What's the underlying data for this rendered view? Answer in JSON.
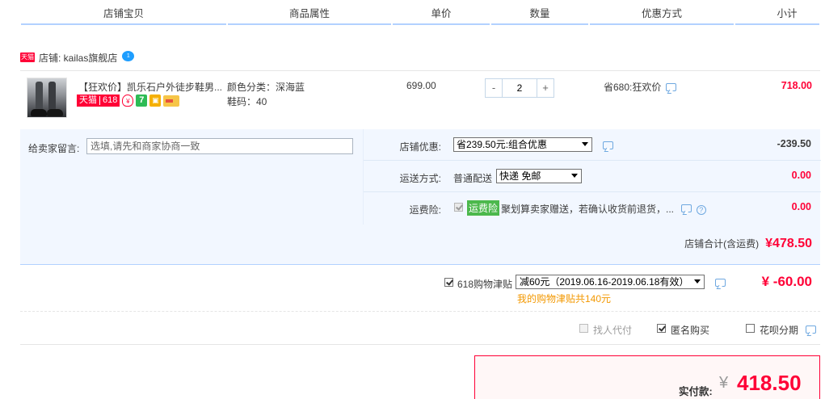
{
  "columns": {
    "item": "店铺宝贝",
    "attrs": "商品属性",
    "unit_price": "单价",
    "quantity": "数量",
    "discount_type": "优惠方式",
    "subtotal": "小计"
  },
  "shop": {
    "badge": "天猫",
    "name": "店铺: kailas旗舰店",
    "chat_badge": "1"
  },
  "item": {
    "title": "【狂欢价】凯乐石户外徒步鞋男...",
    "badge_tmall": "天猫",
    "badge_618": "618",
    "badge_guarantee": "¥",
    "badge_seven": "7",
    "attr_color": "颜色分类：深海蓝",
    "attr_size": "鞋码：40",
    "unit_price": "699.00",
    "qty_minus": "-",
    "qty_value": "2",
    "qty_plus": "+",
    "discount_text": "省680:狂欢价",
    "subtotal": "718.00"
  },
  "order": {
    "note_label": "给卖家留言:",
    "note_placeholder": "选填,请先和商家协商一致",
    "shop_coupon_label": "店铺优惠:",
    "shop_coupon_selected": "省239.50元:组合优惠",
    "shop_coupon_value": "-239.50",
    "shipping_label": "运送方式:",
    "shipping_type": "普通配送",
    "shipping_selected": "快递 免邮",
    "shipping_value": "0.00",
    "insurance_label": "运费险:",
    "insurance_tag": "运费险",
    "insurance_text": "聚划算卖家赠送，若确认收货前退货，...",
    "insurance_value": "0.00",
    "shop_total_label": "店铺合计(含运费)",
    "shop_total_value": "¥478.50"
  },
  "subsidy": {
    "label": "618购物津贴",
    "selected": "减60元（2019.06.16-2019.06.18有效）",
    "note": "我的购物津贴共140元",
    "value": "¥ -60.00"
  },
  "extras": {
    "proxy_pay": "找人代付",
    "anonymous": "匿名购买",
    "huabei": "花呗分期"
  },
  "payment": {
    "label": "实付款:",
    "currency": "¥",
    "value": "418.50"
  },
  "colors": {
    "accent_red": "#ff0036",
    "header_line": "#b2d1ff",
    "panel_bg": "#f2f7ff",
    "subsidy_note": "#f39800"
  }
}
